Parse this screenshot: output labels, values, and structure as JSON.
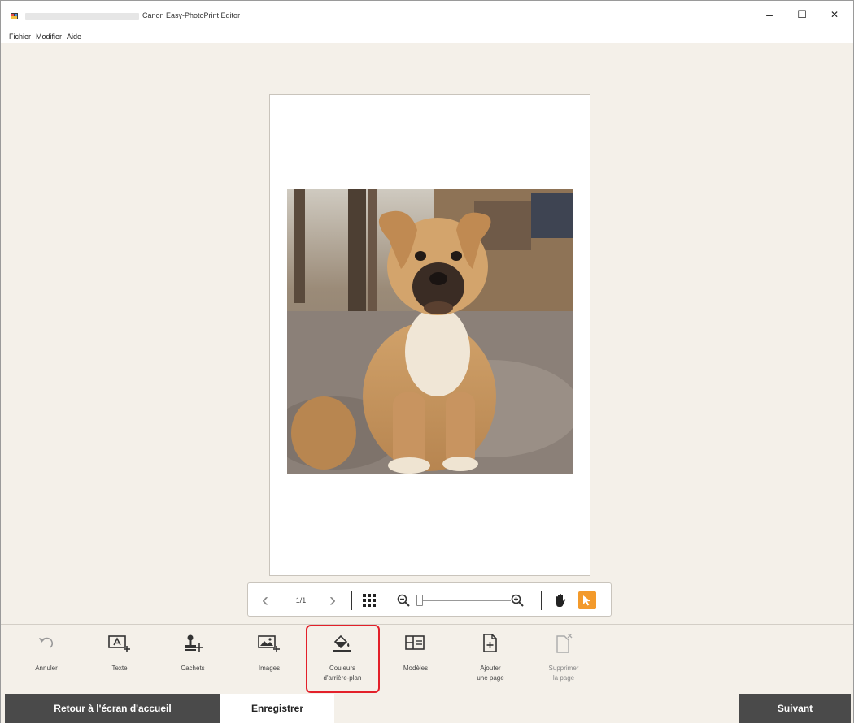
{
  "window": {
    "title": "Canon Easy-PhotoPrint Editor",
    "minimize_glyph": "–",
    "maximize_glyph": "☐",
    "close_glyph": "✕"
  },
  "menu": [
    "Fichier",
    "Modifier",
    "Aide"
  ],
  "canvas": {
    "photo_subject": "puppy photo"
  },
  "navigator": {
    "page_indicator": "1/1",
    "prev_glyph": "‹",
    "next_glyph": "›"
  },
  "tools": [
    {
      "label": "Annuler",
      "icon": "undo-icon"
    },
    {
      "label": "Texte",
      "icon": "text-box-icon"
    },
    {
      "label": "Cachets",
      "icon": "stamp-icon"
    },
    {
      "label": "Images",
      "icon": "image-add-icon"
    },
    {
      "label": "Couleurs\nd'arrière-plan",
      "icon": "paint-bucket-icon",
      "selected": true
    },
    {
      "label": "Modèles",
      "icon": "layout-icon"
    },
    {
      "label": "Ajouter\nune page",
      "icon": "add-page-icon"
    },
    {
      "label": "Supprimer\nla page",
      "icon": "delete-page-icon",
      "disabled": true
    }
  ],
  "footer": {
    "home_label": "Retour à l'écran d'accueil",
    "save_label": "Enregistrer",
    "next_label": "Suivant"
  },
  "colors": {
    "accent": "#f39a2b",
    "highlight": "#e3202a",
    "dark_button": "#4a4a4a",
    "background": "#f4f0e9"
  }
}
